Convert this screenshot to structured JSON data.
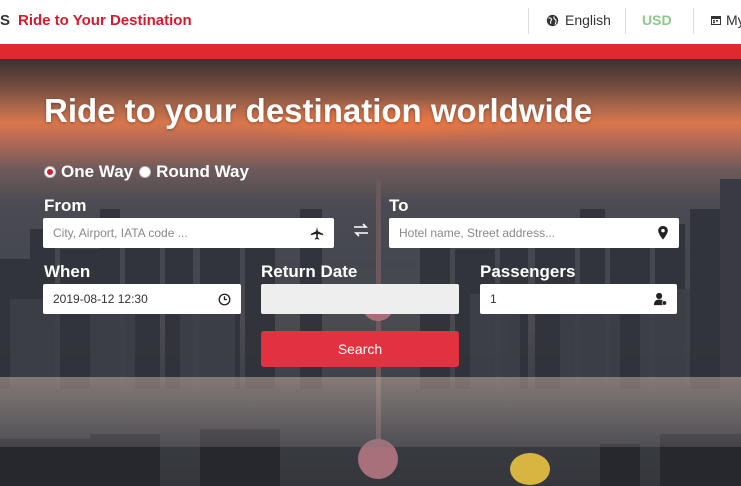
{
  "header": {
    "brand_fragment": "S",
    "tagline": "Ride to Your Destination",
    "language": "English",
    "currency": "USD",
    "account": "My"
  },
  "hero": {
    "headline": "Ride to your destination worldwide"
  },
  "trip_type": {
    "options": [
      {
        "label": "One Way",
        "checked": true
      },
      {
        "label": "Round Way",
        "checked": false
      }
    ]
  },
  "form": {
    "from": {
      "label": "From",
      "placeholder": "City, Airport, IATA code ..."
    },
    "to": {
      "label": "To",
      "placeholder": "Hotel name, Street address..."
    },
    "when": {
      "label": "When",
      "value": "2019-08-12 12:30"
    },
    "return_date": {
      "label": "Return Date",
      "value": ""
    },
    "passengers": {
      "label": "Passengers",
      "value": "1"
    },
    "search_label": "Search"
  },
  "colors": {
    "brand_red": "#d9182d",
    "bar_red": "#e0282f",
    "button_red": "#e3323f",
    "currency_green": "#8cc88c"
  },
  "icons": {
    "language": "globe-icon",
    "account": "calendar-icon",
    "from": "airplane-icon",
    "to": "map-pin-icon",
    "swap": "swap-arrows-icon",
    "when": "clock-icon",
    "passengers": "person-icon"
  }
}
